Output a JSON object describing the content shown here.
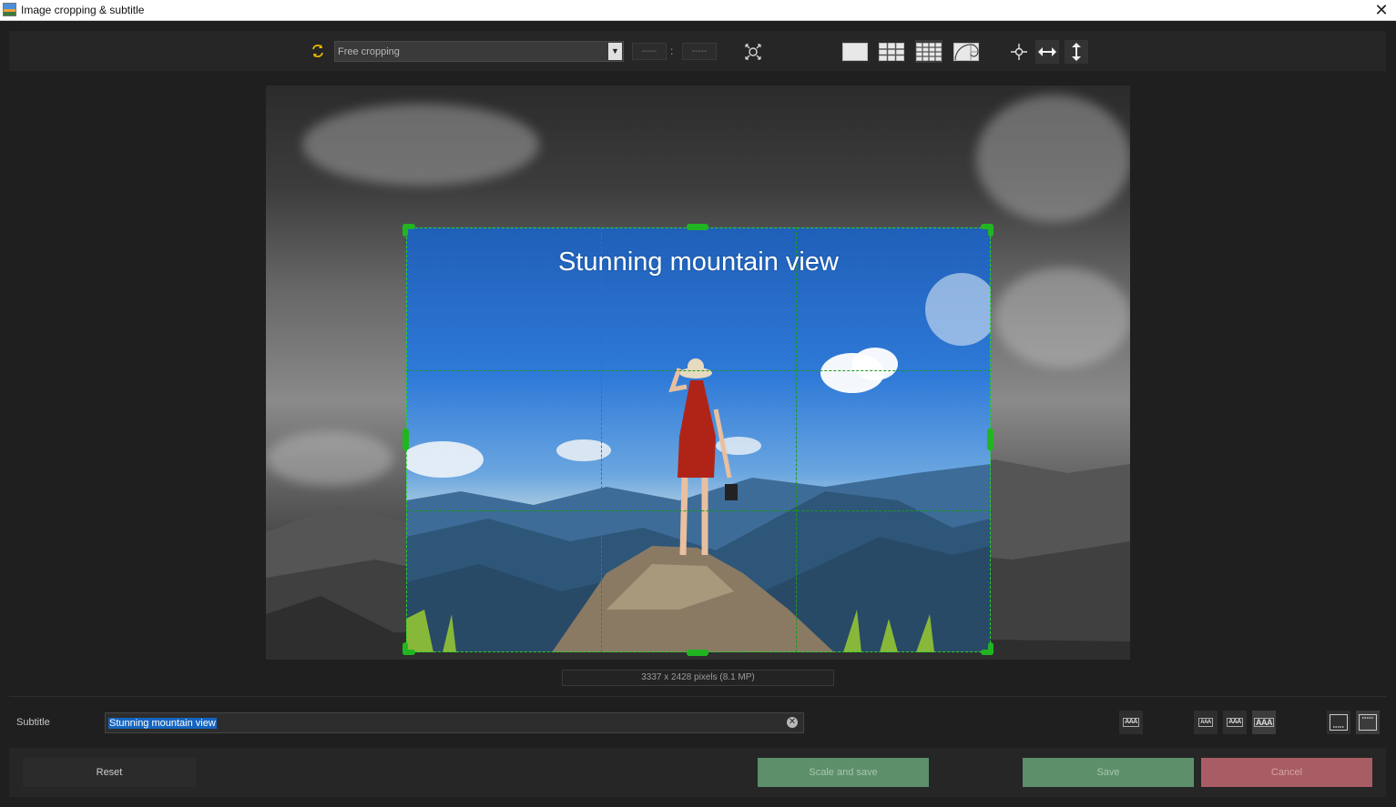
{
  "window": {
    "title": "Image cropping & subtitle",
    "close_glyph": "✕"
  },
  "toolbar": {
    "crop_mode": "Free cropping",
    "ratio_width_placeholder": "-----",
    "ratio_height_placeholder": "-----",
    "ratio_separator": ":",
    "icons": [
      "ratio-swap-icon",
      "center-crop-icon",
      "no-grid-icon",
      "grid-3x3-icon",
      "grid-4x4-icon",
      "golden-spiral-icon",
      "center-point-icon",
      "horizontal-extend-icon",
      "vertical-extend-icon"
    ]
  },
  "image": {
    "subtitle_overlay": "Stunning mountain view",
    "info": "3337 x 2428 pixels (8.1 MP)"
  },
  "subtitle": {
    "label": "Subtitle",
    "value": "Stunning mountain view",
    "style_buttons": [
      "AAA",
      "AAA",
      "AAA",
      "AAA"
    ]
  },
  "footer": {
    "reset": "Reset",
    "scale_and_save": "Scale and save",
    "save": "Save",
    "cancel": "Cancel"
  },
  "colors": {
    "crop_handle": "#22b522",
    "save_button": "#5e8f6b",
    "cancel_button": "#a85c63",
    "selection": "#1565c0"
  }
}
